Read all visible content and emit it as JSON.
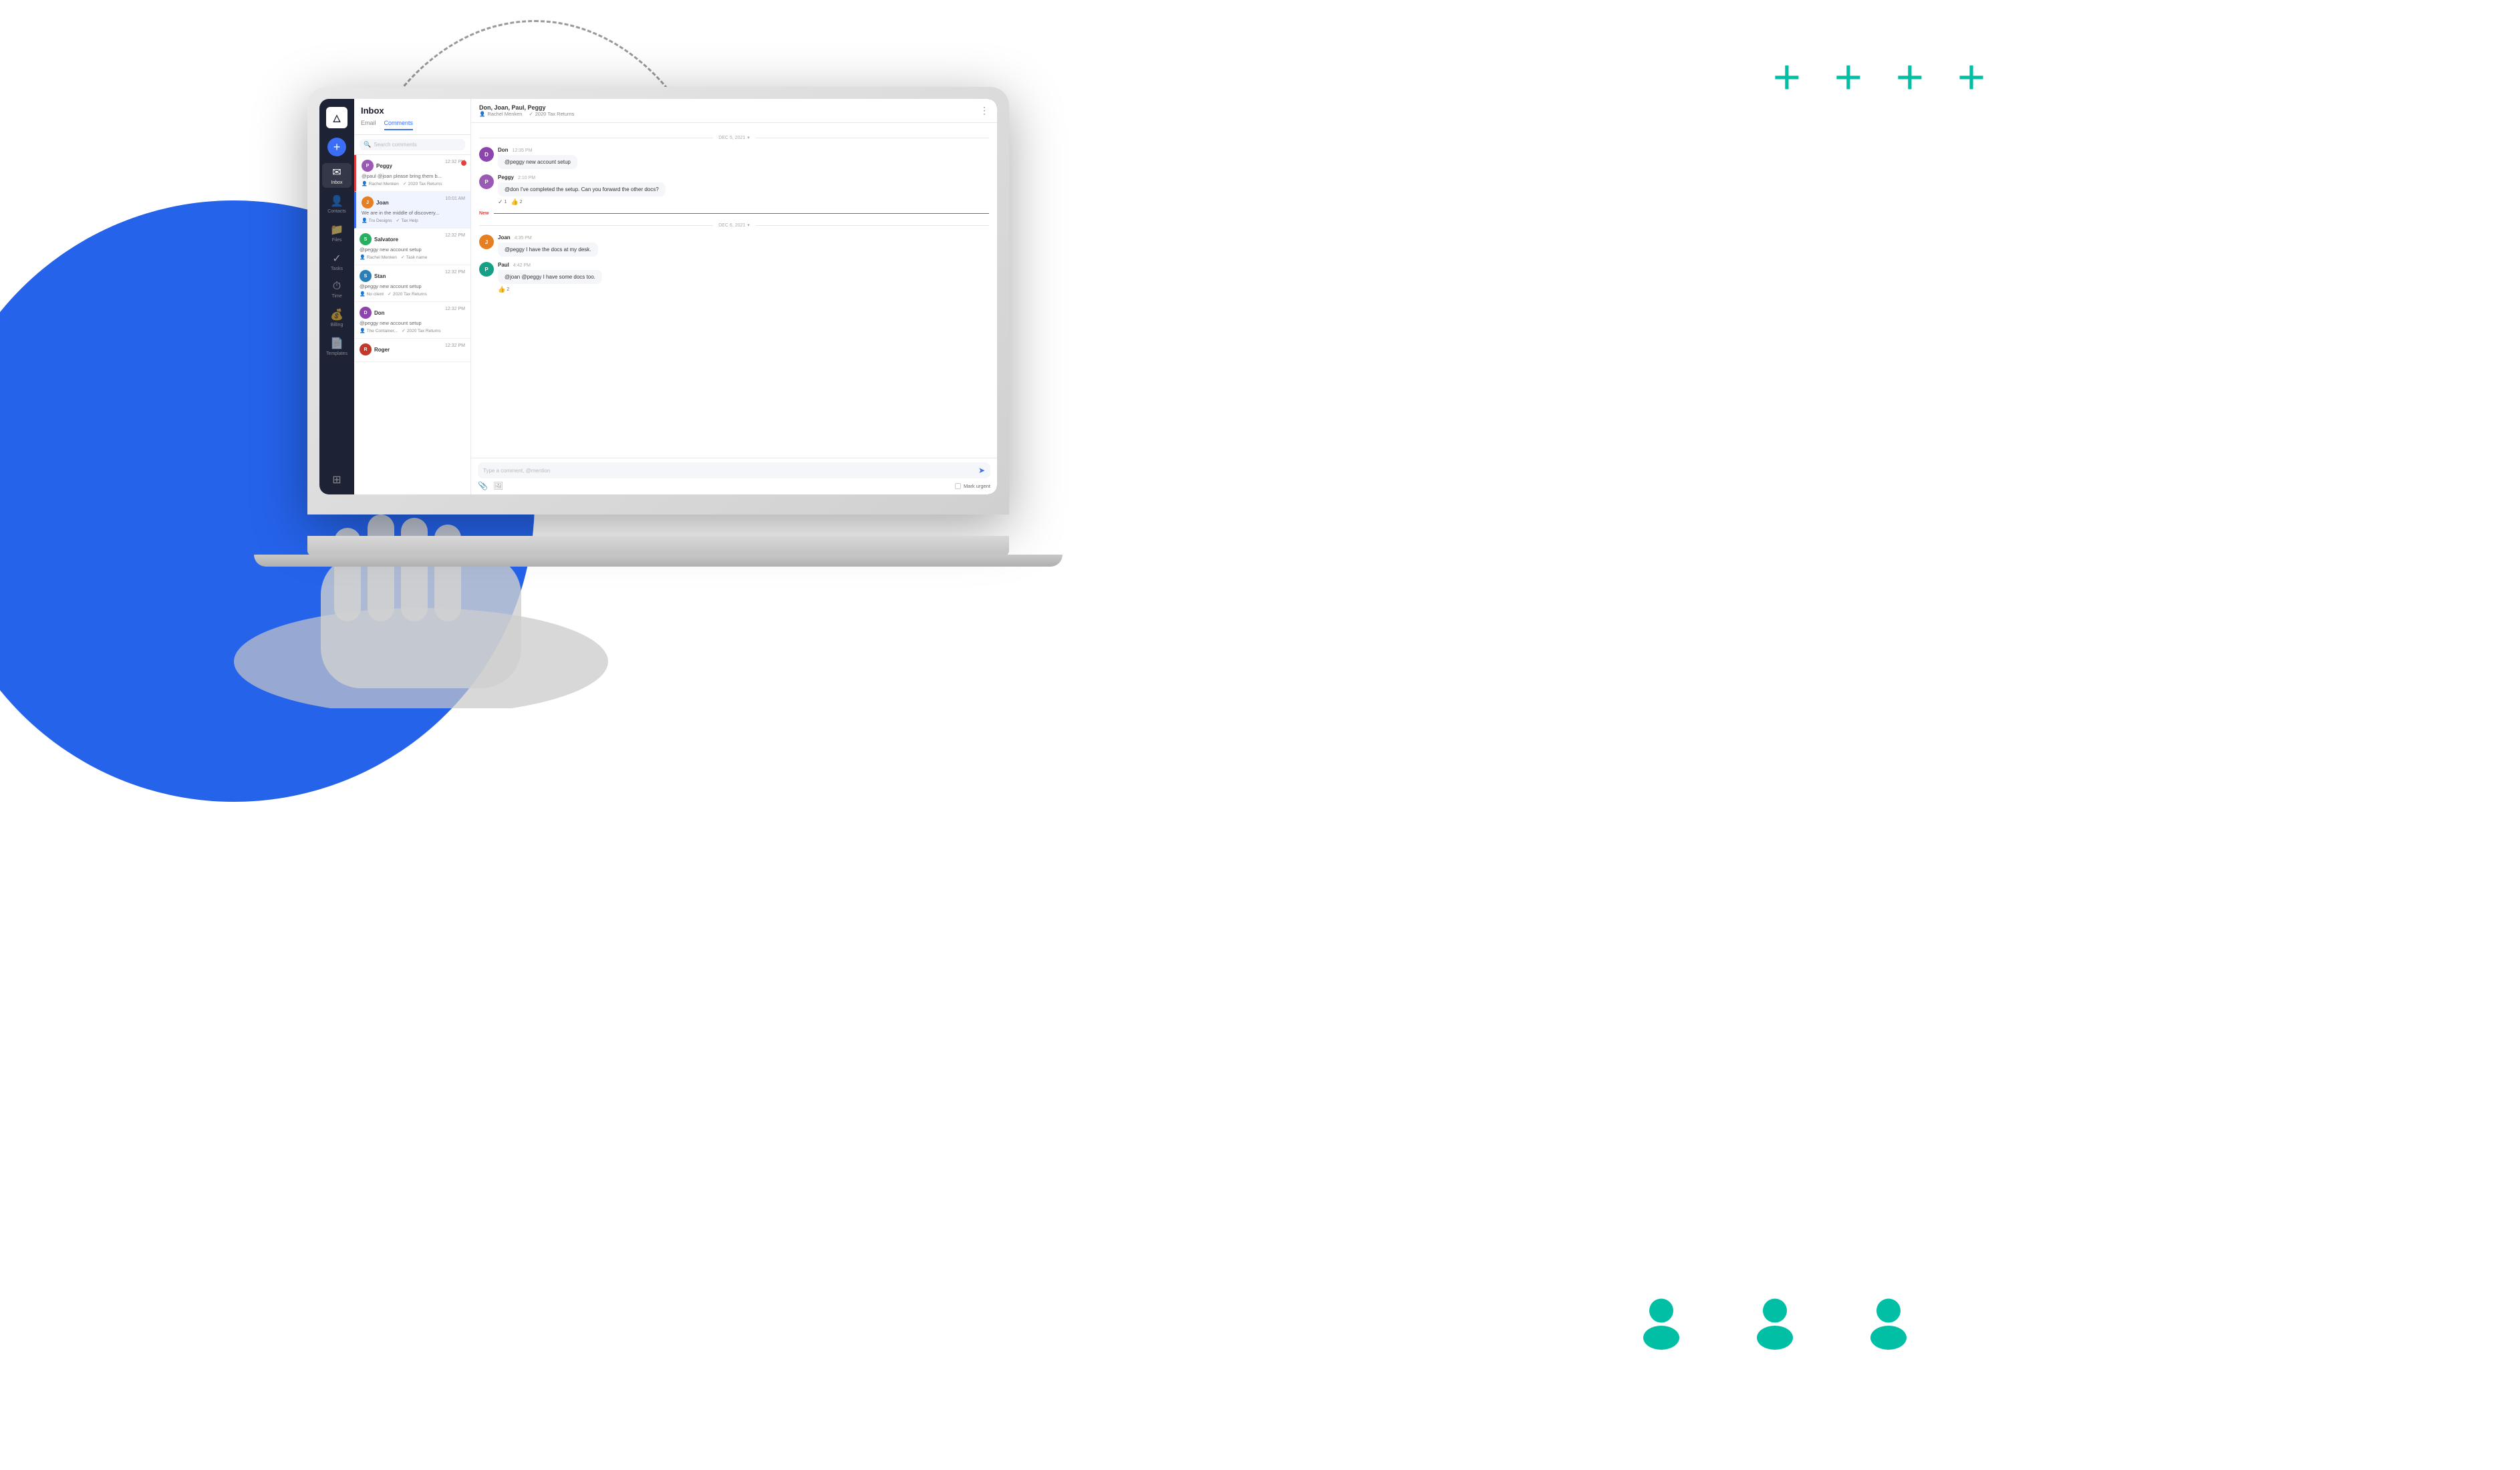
{
  "page": {
    "title": "Inbox - Comments",
    "bg_accent_color": "#2563eb",
    "teal_color": "#00bfa5"
  },
  "decorative": {
    "plus_signs": [
      "+",
      "+",
      "+",
      "+"
    ],
    "user_icon_count": 3
  },
  "app": {
    "logo": "△",
    "logo_label": "App Logo"
  },
  "nav": {
    "add_button_label": "+",
    "items": [
      {
        "id": "inbox",
        "label": "Inbox",
        "icon": "✉",
        "active": true
      },
      {
        "id": "contacts",
        "label": "Contacts",
        "icon": "👤",
        "active": false
      },
      {
        "id": "files",
        "label": "Files",
        "icon": "📁",
        "active": false
      },
      {
        "id": "tasks",
        "label": "Tasks",
        "icon": "✓",
        "active": false
      },
      {
        "id": "time",
        "label": "Time",
        "icon": "⏱",
        "active": false
      },
      {
        "id": "billing",
        "label": "Billing",
        "icon": "💰",
        "active": false
      },
      {
        "id": "templates",
        "label": "Templates",
        "icon": "📄",
        "active": false
      }
    ],
    "bottom_icon": "⊞"
  },
  "inbox": {
    "title": "Inbox",
    "tabs": [
      {
        "id": "email",
        "label": "Email",
        "active": false
      },
      {
        "id": "comments",
        "label": "Comments",
        "active": true
      }
    ],
    "search_placeholder": "Search comments",
    "items": [
      {
        "id": "peggy",
        "name": "Peggy",
        "time": "12:32 PM",
        "preview": "@paul @joan please bring them b...",
        "client": "Rachel Menken",
        "task": "2020 Tax Returns",
        "unread": true,
        "avatar_initial": "P",
        "avatar_class": "avatar-peggy"
      },
      {
        "id": "joan",
        "name": "Joan",
        "time": "10:01 AM",
        "preview": "We are in the middle of discovery...",
        "client": "Tru Designs",
        "task": "Tax Help",
        "unread": false,
        "active": true,
        "avatar_initial": "J",
        "avatar_class": "avatar-joan"
      },
      {
        "id": "salvatore",
        "name": "Salvatore",
        "time": "12:32 PM",
        "preview": "@peggy new account setup",
        "client": "Rachel Menken",
        "task": "Task name",
        "unread": false,
        "avatar_initial": "S",
        "avatar_class": "avatar-salvatore"
      },
      {
        "id": "stan",
        "name": "Stan",
        "time": "12:32 PM",
        "preview": "@peggy new account setup",
        "client": "No client",
        "task": "2020 Tax Returns",
        "unread": false,
        "avatar_initial": "S",
        "avatar_class": "avatar-stan"
      },
      {
        "id": "don",
        "name": "Don",
        "time": "12:32 PM",
        "preview": "@peggy new account setup",
        "client": "The Container...",
        "task": "2020 Tax Returns",
        "unread": false,
        "avatar_initial": "D",
        "avatar_class": "avatar-don"
      },
      {
        "id": "roger",
        "name": "Roger",
        "time": "12:32 PM",
        "preview": "",
        "client": "",
        "task": "",
        "unread": false,
        "avatar_initial": "R",
        "avatar_class": "avatar-roger"
      }
    ]
  },
  "chat": {
    "participants": "Don, Joan, Paul, Peggy",
    "linked_contact": "Rachel Menken",
    "linked_task": "2020 Tax Returns",
    "more_icon": "⋮",
    "date_groups": [
      {
        "date": "DEC 5, 2021",
        "messages": [
          {
            "sender": "Don",
            "time": "12:35 PM",
            "text": "@peggy new account setup",
            "avatar_initial": "D",
            "avatar_class": "avatar-don",
            "reactions": []
          },
          {
            "sender": "Peggy",
            "time": "2:10 PM",
            "text": "@don I've completed the setup. Can you forward the other docs?",
            "avatar_initial": "P",
            "avatar_class": "avatar-peggy",
            "reactions": [
              {
                "icon": "✓",
                "count": "1"
              },
              {
                "icon": "👍",
                "count": "2"
              }
            ]
          }
        ]
      },
      {
        "date": "DEC 6, 2021",
        "new_marker": true,
        "messages": [
          {
            "sender": "Joan",
            "time": "4:35 PM",
            "text": "@peggy I have the docs at my desk.",
            "avatar_initial": "J",
            "avatar_class": "avatar-joan",
            "reactions": []
          },
          {
            "sender": "Paul",
            "time": "4:42 PM",
            "text": "@joan @peggy I have some docs too.",
            "avatar_initial": "P",
            "avatar_class": "avatar-paul",
            "reactions": [
              {
                "icon": "👍",
                "count": "2"
              }
            ]
          }
        ]
      }
    ],
    "input_placeholder": "Type a comment, @mention",
    "mark_urgent_label": "Mark urgent",
    "attach_icon": "📎",
    "image_icon": "🖼"
  }
}
